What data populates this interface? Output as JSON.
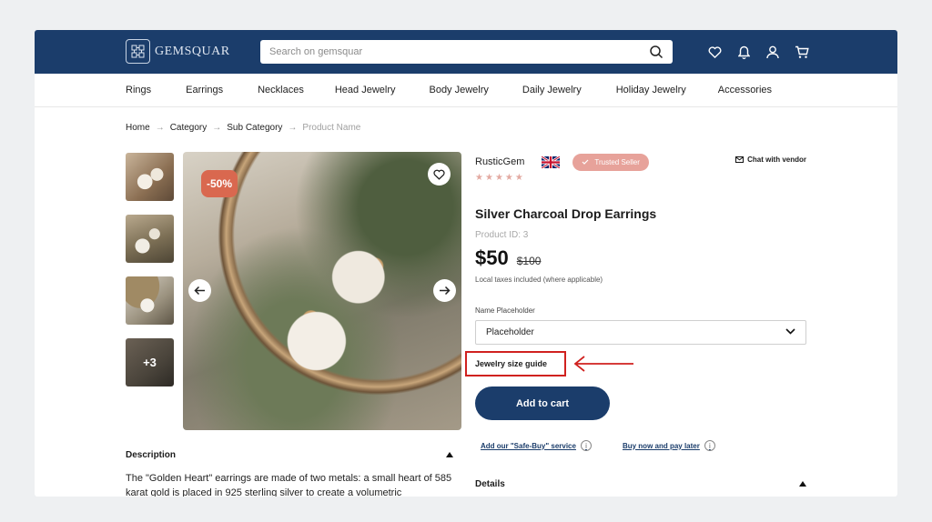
{
  "header": {
    "logo_text": "GEMSQUAR",
    "search": {
      "placeholder": "Search on gemsquar"
    },
    "icons": [
      "heart-icon",
      "bell-icon",
      "user-icon",
      "cart-icon"
    ]
  },
  "categories": [
    "Rings",
    "Earrings",
    "Necklaces",
    "Head Jewelry",
    "Body Jewelry",
    "Daily Jewelry",
    "Holiday Jewelry",
    "Accessories"
  ],
  "breadcrumb": {
    "home": "Home",
    "category": "Category",
    "subcategory": "Sub Category",
    "current": "Product Name"
  },
  "gallery": {
    "more_label": "+3",
    "discount": "-50%"
  },
  "seller": {
    "name": "RusticGem",
    "trusted": "Trusted Seller",
    "chat": "Chat with vendor",
    "rating": 5
  },
  "product": {
    "title": "Silver Charcoal Drop Earrings",
    "id": "Product ID: 3",
    "price": "$50",
    "old_price": "$100",
    "taxes": "Local taxes included (where applicable)",
    "select_label": "Name Placeholder",
    "select_value": "Placeholder",
    "size_guide": "Jewelry size guide",
    "add_to_cart": "Add to cart",
    "safe_buy": "Add our \"Safe-Buy\" service",
    "pay_later": "Buy now and pay later"
  },
  "description": {
    "heading": "Description",
    "text": "The \"Golden Heart\" earrings are made of two metals: a small heart of 585 karat gold is placed in 925 sterling silver to create a volumetric"
  },
  "details": {
    "heading": "Details"
  },
  "colors": {
    "primary": "#1b3d6b",
    "discount": "#d9684f",
    "trusted": "#e7a29a",
    "highlight": "#d0211f"
  }
}
